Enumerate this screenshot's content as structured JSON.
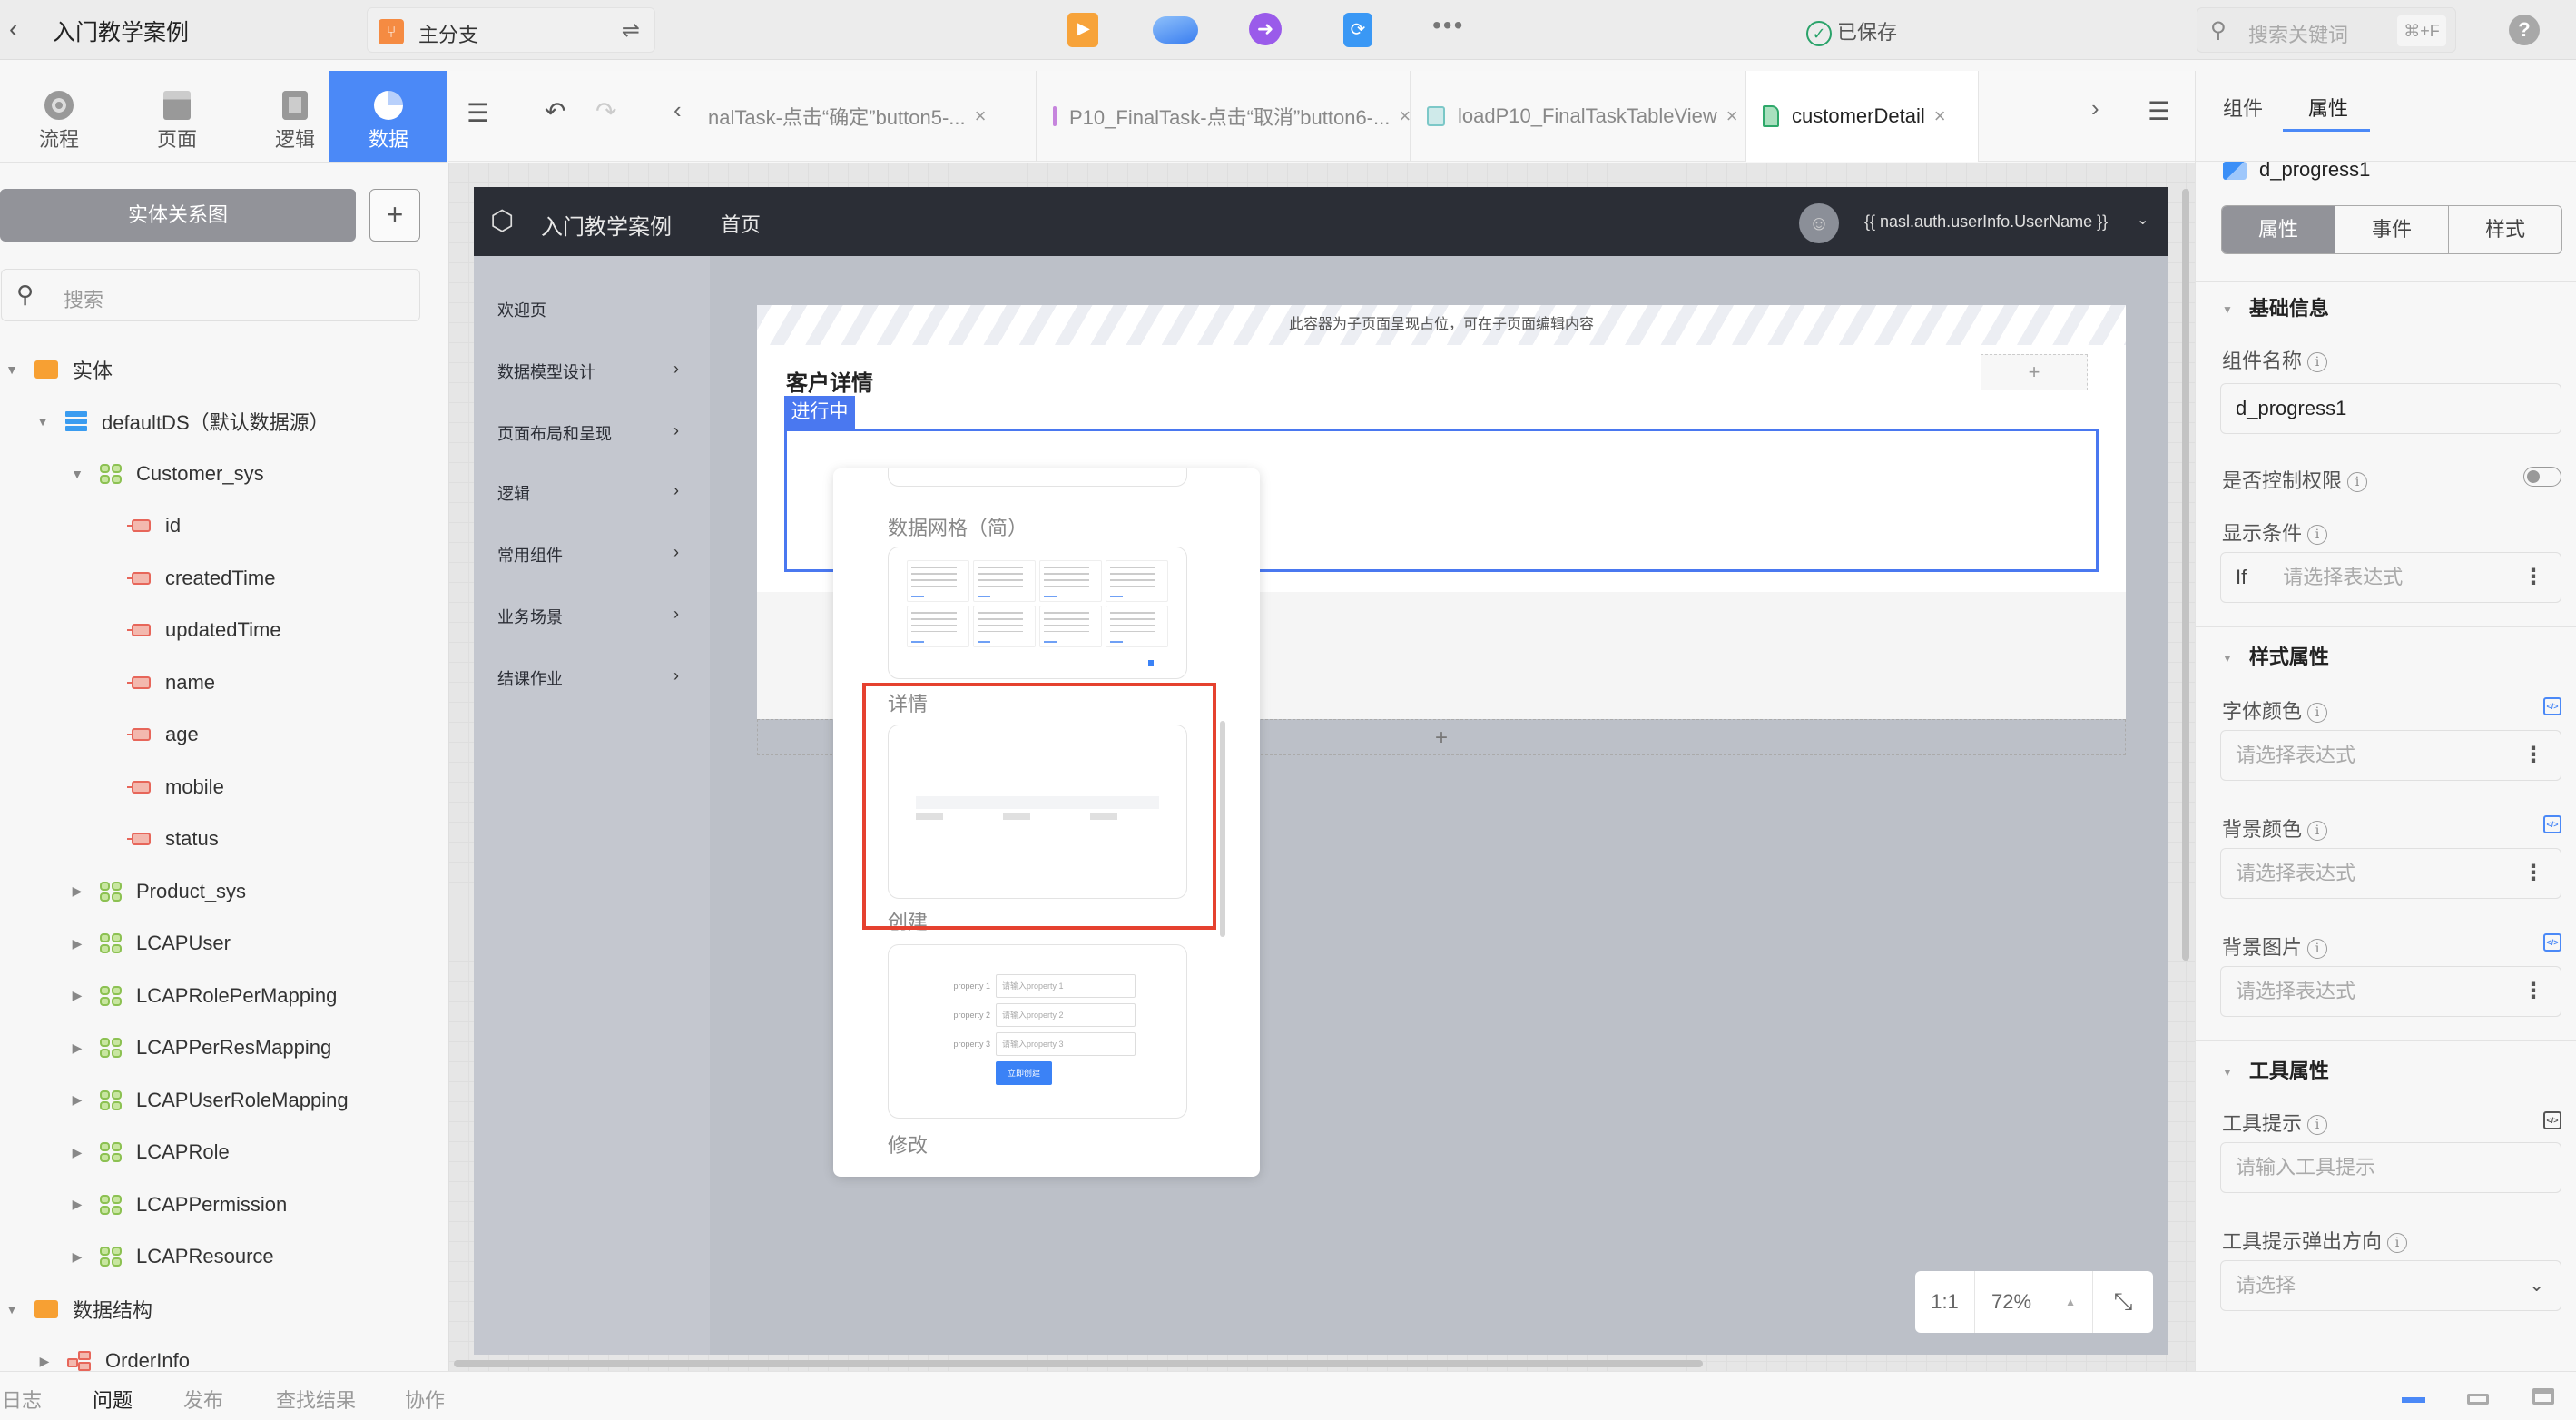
{
  "topbar": {
    "back_icon": "chevron-left-icon",
    "app_title": "入门教学案例",
    "branch_label": "主分支",
    "branch_icon": "git-branch-icon",
    "swap_icon": "swap-icon",
    "tool_icons": [
      "preview-icon",
      "cloud-deploy-icon",
      "publish-icon",
      "sync-icon"
    ],
    "more_icon": "more-icon",
    "saved_status": "已保存",
    "search_placeholder": "搜索关键词",
    "search_shortcut": "⌘+F",
    "help_icon": "help-icon"
  },
  "left_nav": [
    {
      "label": "流程",
      "icon": "process-icon",
      "active": false
    },
    {
      "label": "页面",
      "icon": "page-icon",
      "active": false
    },
    {
      "label": "逻辑",
      "icon": "logic-icon",
      "active": false
    },
    {
      "label": "数据",
      "icon": "data-pie-icon",
      "active": true
    }
  ],
  "left_panel": {
    "er_button": "实体关系图",
    "add_button": "+",
    "search_placeholder": "搜索",
    "tree": [
      {
        "label": "实体",
        "type": "folder",
        "level": 0,
        "expanded": true
      },
      {
        "label": "defaultDS（默认数据源）",
        "type": "datasource",
        "level": 1,
        "expanded": true
      },
      {
        "label": "Customer_sys",
        "type": "entity",
        "level": 2,
        "expanded": true
      },
      {
        "label": "id",
        "type": "field",
        "level": 3
      },
      {
        "label": "createdTime",
        "type": "field",
        "level": 3
      },
      {
        "label": "updatedTime",
        "type": "field",
        "level": 3
      },
      {
        "label": "name",
        "type": "field",
        "level": 3
      },
      {
        "label": "age",
        "type": "field",
        "level": 3
      },
      {
        "label": "mobile",
        "type": "field",
        "level": 3
      },
      {
        "label": "status",
        "type": "field",
        "level": 3
      },
      {
        "label": "Product_sys",
        "type": "entity",
        "level": 2,
        "expanded": false
      },
      {
        "label": "LCAPUser",
        "type": "entity",
        "level": 2,
        "expanded": false
      },
      {
        "label": "LCAPRolePerMapping",
        "type": "entity",
        "level": 2,
        "expanded": false
      },
      {
        "label": "LCAPPerResMapping",
        "type": "entity",
        "level": 2,
        "expanded": false
      },
      {
        "label": "LCAPUserRoleMapping",
        "type": "entity",
        "level": 2,
        "expanded": false
      },
      {
        "label": "LCAPRole",
        "type": "entity",
        "level": 2,
        "expanded": false
      },
      {
        "label": "LCAPPermission",
        "type": "entity",
        "level": 2,
        "expanded": false
      },
      {
        "label": "LCAPResource",
        "type": "entity",
        "level": 2,
        "expanded": false
      },
      {
        "label": "数据结构",
        "type": "folder",
        "level": 0,
        "expanded": true
      },
      {
        "label": "OrderInfo",
        "type": "struct",
        "level": 1,
        "expanded": false
      }
    ]
  },
  "editor_tabs": {
    "tabs": [
      {
        "label": "nalTask-点击“确定”button5-...",
        "icon": "",
        "active": false
      },
      {
        "label": "P10_FinalTask-点击“取消”button6-...",
        "icon": "logic-flow-icon",
        "active": false
      },
      {
        "label": "loadP10_FinalTaskTableView",
        "icon": "logic-flow-icon",
        "active": false
      },
      {
        "label": "customerDetail",
        "icon": "page-file-icon",
        "active": true
      }
    ],
    "close_glyph": "×"
  },
  "preview": {
    "app_name": "入门教学案例",
    "nav_home": "首页",
    "username": "{{ nasl.auth.userInfo.UserName }}",
    "side_menu": [
      {
        "label": "欢迎页",
        "has_children": false
      },
      {
        "label": "数据模型设计",
        "has_children": true
      },
      {
        "label": "页面布局和呈现",
        "has_children": true
      },
      {
        "label": "逻辑",
        "has_children": true
      },
      {
        "label": "常用组件",
        "has_children": true
      },
      {
        "label": "业务场景",
        "has_children": true
      },
      {
        "label": "结课作业",
        "has_children": true
      }
    ],
    "placeholder_hint": "此容器为子页面呈现占位，可在子页面编辑内容",
    "detail_title": "客户详情",
    "status_tag": "进行中",
    "add_glyph": "+"
  },
  "template_popup": {
    "sections": [
      {
        "title": "数据网格（简）"
      },
      {
        "title": "详情"
      },
      {
        "title": "创建"
      },
      {
        "title": "修改"
      }
    ],
    "create_form": {
      "fields": [
        {
          "label": "property 1",
          "placeholder": "请输入property 1"
        },
        {
          "label": "property 2",
          "placeholder": "请输入property 2"
        },
        {
          "label": "property 3",
          "placeholder": "请输入property 3"
        }
      ],
      "submit": "立即创建"
    }
  },
  "zoom_control": {
    "reset": "1:1",
    "level": "72%",
    "fit_icon": "collapse-icon"
  },
  "right_panel": {
    "tabs": [
      {
        "label": "组件",
        "active": false
      },
      {
        "label": "属性",
        "active": true
      }
    ],
    "component_name": "d_progress1",
    "segments": [
      {
        "label": "属性",
        "active": true
      },
      {
        "label": "事件",
        "active": false
      },
      {
        "label": "样式",
        "active": false
      }
    ],
    "basic_section": "基础信息",
    "name_label": "组件名称",
    "name_value": "d_progress1",
    "permission_label": "是否控制权限",
    "permission_enabled": false,
    "display_label": "显示条件",
    "display_prefix": "If",
    "expr_placeholder": "请选择表达式",
    "style_section": "样式属性",
    "font_color_label": "字体颜色",
    "bg_color_label": "背景颜色",
    "bg_image_label": "背景图片",
    "tool_section": "工具属性",
    "tooltip_label": "工具提示",
    "tooltip_placeholder": "请输入工具提示",
    "tooltip_dir_label": "工具提示弹出方向",
    "tooltip_dir_placeholder": "请选择"
  },
  "bottom_bar": {
    "tabs": [
      {
        "label": "日志",
        "active": false
      },
      {
        "label": "问题",
        "active": true
      },
      {
        "label": "发布",
        "active": false
      },
      {
        "label": "查找结果",
        "active": false
      },
      {
        "label": "协作",
        "active": false
      }
    ]
  },
  "colors": {
    "accent": "#4b89f7",
    "highlight_red": "#e5412f",
    "preview_nav": "#2b2e36",
    "saved_green": "#2aa36a"
  }
}
